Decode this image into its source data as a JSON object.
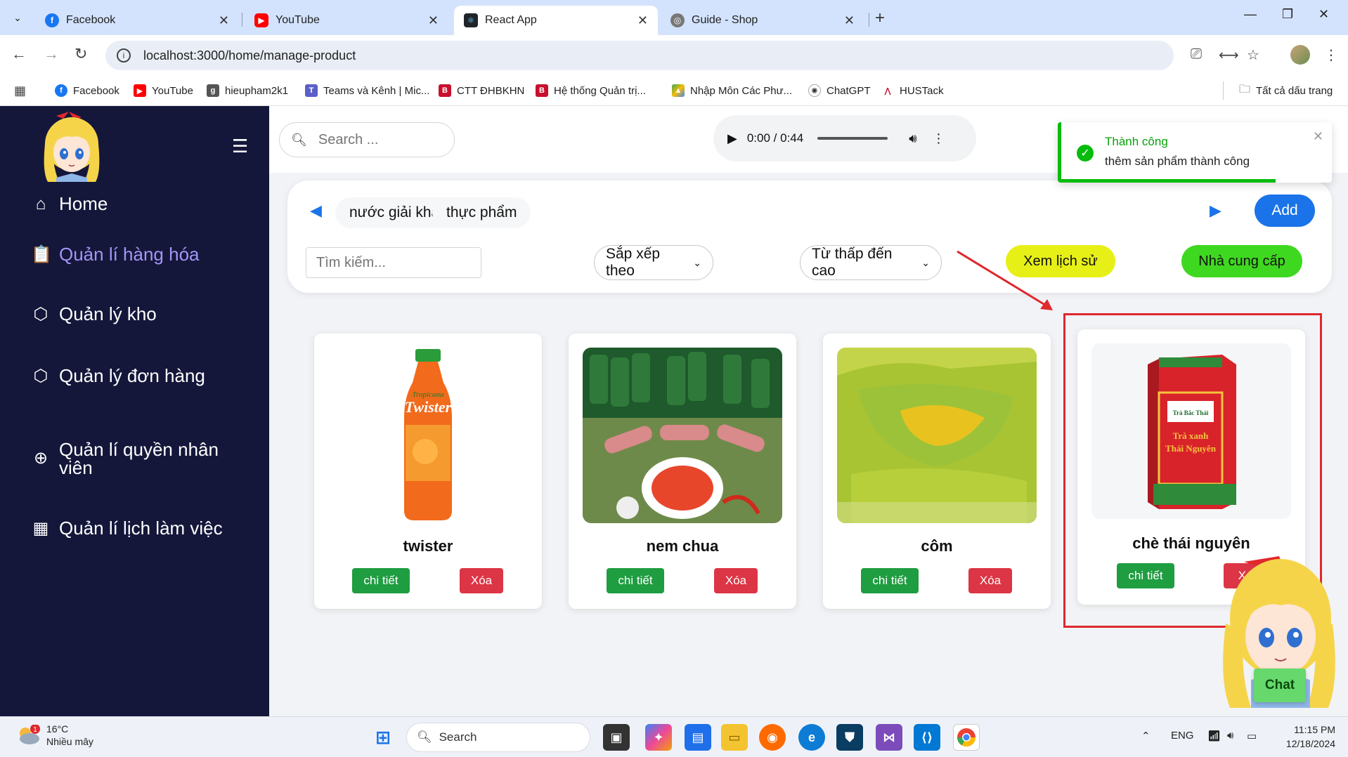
{
  "browser": {
    "tabs": [
      {
        "label": "Facebook",
        "icon": "facebook-icon",
        "active": false
      },
      {
        "label": "YouTube",
        "icon": "youtube-icon",
        "active": false
      },
      {
        "label": "React App",
        "icon": "react-icon",
        "active": true
      },
      {
        "label": "Guide - Shop",
        "icon": "globe-icon",
        "active": false
      }
    ],
    "url": "localhost:3000/home/manage-product",
    "bookmarks": [
      {
        "label": "Facebook"
      },
      {
        "label": "YouTube"
      },
      {
        "label": "hieupham2k1"
      },
      {
        "label": "Teams và Kênh | Mic..."
      },
      {
        "label": "CTT ĐHBKHN"
      },
      {
        "label": "Hệ thống Quản trị..."
      },
      {
        "label": "Nhập Môn Các Phư..."
      },
      {
        "label": "ChatGPT"
      },
      {
        "label": "HUSTack"
      }
    ],
    "all_bookmarks": "Tất cả dấu trang"
  },
  "sidebar": {
    "items": [
      {
        "label": "Home",
        "icon": "home-icon",
        "active": false
      },
      {
        "label": "Quản lí hàng hóa",
        "icon": "clipboard-check-icon",
        "active": true
      },
      {
        "label": "Quản lý kho",
        "icon": "warehouse-icon",
        "active": false
      },
      {
        "label": "Quản lý đơn hàng",
        "icon": "box-icon",
        "active": false
      },
      {
        "label": "Quản lí quyền nhân viên",
        "icon": "plus-circle-icon",
        "active": false
      },
      {
        "label": "Quản lí lịch làm việc",
        "icon": "calendar-icon",
        "active": false
      }
    ]
  },
  "topbar": {
    "search_placeholder": "Search ...",
    "audio_time": "0:00 / 0:44"
  },
  "toolbar": {
    "categories": [
      "nước giải khát",
      "thực phẩm"
    ],
    "add_label": "Add",
    "filter_placeholder": "Tìm kiếm...",
    "sort_label": "Sắp xếp theo",
    "order_label": "Từ thấp đến cao",
    "history_label": "Xem lịch sử",
    "supplier_label": "Nhà cung cấp"
  },
  "products": [
    {
      "name": "twister",
      "detail_label": "chi tiết",
      "delete_label": "Xóa"
    },
    {
      "name": "nem chua",
      "detail_label": "chi tiết",
      "delete_label": "Xóa"
    },
    {
      "name": "côm",
      "detail_label": "chi tiết",
      "delete_label": "Xóa"
    },
    {
      "name": "chè thái nguyên",
      "detail_label": "chi tiết",
      "delete_label": "Xó"
    }
  ],
  "product_images": {
    "twister_bottle": [
      "Tropicana",
      "Twister"
    ],
    "tea_box": [
      "Trà Bắc Thái",
      "Trà xanh",
      "Thái Nguyên"
    ]
  },
  "toast": {
    "title": "Thành công",
    "message": "thêm sản phẩm thành công"
  },
  "chat_label": "Chat",
  "taskbar": {
    "temperature": "16°C",
    "weather": "Nhiều mây",
    "weather_badge": "1",
    "search_label": "Search",
    "language": "ENG",
    "time": "11:15 PM",
    "date": "12/18/2024"
  },
  "colors": {
    "sidebar_bg": "#14173a",
    "active_menu": "#a395f5",
    "primary": "#1a73e8",
    "detail_green": "#1f9d41",
    "delete_red": "#dc3545",
    "history_yellow": "#e7f016",
    "supplier_green": "#3fd820",
    "highlight_red": "#e0282d"
  }
}
